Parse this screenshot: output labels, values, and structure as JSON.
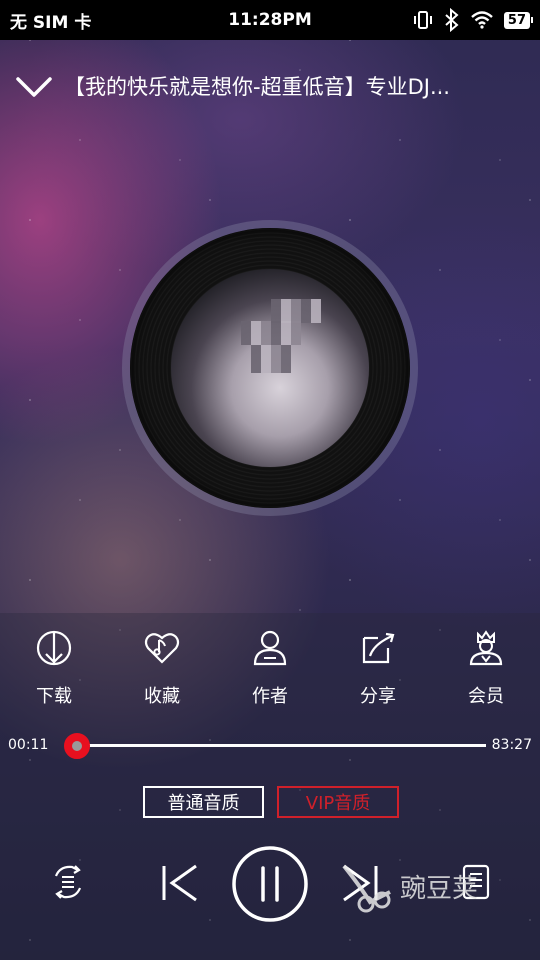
{
  "status_bar": {
    "carrier": "无 SIM 卡",
    "time": "11:28PM",
    "battery": "57"
  },
  "header": {
    "title": "【我的快乐就是想你-超重低音】专业DJ..."
  },
  "actions": [
    {
      "label": "下载",
      "icon": "download-icon"
    },
    {
      "label": "收藏",
      "icon": "heart-icon"
    },
    {
      "label": "作者",
      "icon": "user-icon"
    },
    {
      "label": "分享",
      "icon": "share-icon"
    },
    {
      "label": "会员",
      "icon": "vip-icon"
    }
  ],
  "progress": {
    "current": "00:11",
    "total": "83:27",
    "fraction": 0.002
  },
  "quality": {
    "normal": "普通音质",
    "vip": "VIP音质"
  },
  "watermark": {
    "text": "豌豆荚"
  },
  "colors": {
    "accent": "#e8101f",
    "vip": "#d0202a",
    "status_bar": "#000000"
  }
}
